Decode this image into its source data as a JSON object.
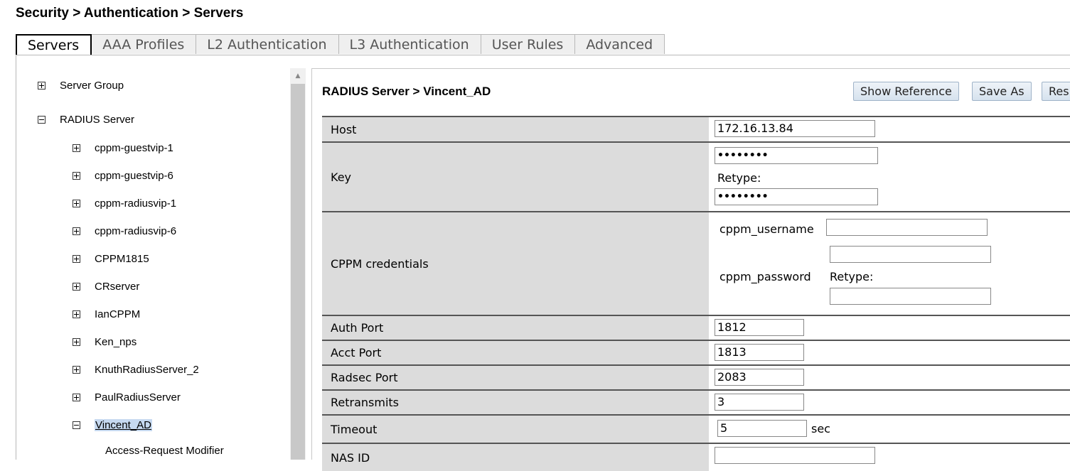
{
  "breadcrumb": "Security > Authentication > Servers",
  "tabs": [
    "Servers",
    "AAA Profiles",
    "L2 Authentication",
    "L3 Authentication",
    "User Rules",
    "Advanced"
  ],
  "tree": {
    "server_group": "Server Group",
    "radius_server": "RADIUS Server",
    "items": [
      "cppm-guestvip-1",
      "cppm-guestvip-6",
      "cppm-radiusvip-1",
      "cppm-radiusvip-6",
      "CPPM1815",
      "CRserver",
      "IanCPPM",
      "Ken_nps",
      "KnuthRadiusServer_2",
      "PaulRadiusServer"
    ],
    "selected": "Vincent_AD",
    "child": "Access-Request Modifier"
  },
  "panel": {
    "title": "RADIUS Server > Vincent_AD",
    "buttons": {
      "show_reference": "Show Reference",
      "save_as": "Save As",
      "reset": "Res"
    }
  },
  "form": {
    "host": {
      "label": "Host",
      "value": "172.16.13.84"
    },
    "key": {
      "label": "Key",
      "value": "••••••••",
      "retype_label": "Retype:",
      "retype_value": "••••••••"
    },
    "cppm": {
      "label": "CPPM credentials",
      "username_label": "cppm_username",
      "username_value": "",
      "password_label": "cppm_password",
      "password_value": "",
      "retype_label": "Retype:",
      "retype_value": ""
    },
    "auth_port": {
      "label": "Auth Port",
      "value": "1812"
    },
    "acct_port": {
      "label": "Acct Port",
      "value": "1813"
    },
    "radsec_port": {
      "label": "Radsec Port",
      "value": "2083"
    },
    "retransmits": {
      "label": "Retransmits",
      "value": "3"
    },
    "timeout": {
      "label": "Timeout",
      "value": "5",
      "unit": "sec"
    },
    "nas_id": {
      "label": "NAS ID",
      "value": ""
    }
  }
}
